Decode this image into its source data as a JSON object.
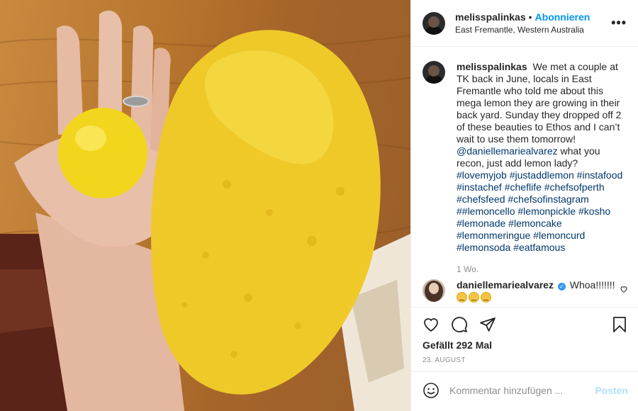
{
  "post": {
    "username": "melisspalinkas",
    "dot": "•",
    "follow_label": "Abonnieren",
    "location": "East Fremantle, Western Australia",
    "more_label": "•••"
  },
  "caption": {
    "username": "melisspalinkas",
    "text": "We met a couple at TK back in June, locals in East Fremantle who told me about this mega lemon they are growing in their back yard. Sunday they dropped off 2 of these beauties to Ethos and I can’t wait to use them tomorrow!",
    "mention": "@daniellemariealvarez",
    "text2": "what you recon, just add lemon lady?",
    "hashtags": [
      "#lovemyjob",
      "#justaddlemon",
      "#instafood",
      "#instachef",
      "#cheflife",
      "#chefsofperth",
      "#chefsfeed",
      "#chefsofinstagram",
      "##lemoncello",
      "#lemonpickle",
      "#kosho",
      "#lemonade",
      "#lemoncake",
      "#lemonmeringue",
      "#lemoncurd",
      "#lemonsoda",
      "#eatfamous"
    ],
    "age": "1 Wo."
  },
  "comment": {
    "username": "daniellemariealvarez",
    "verified_glyph": "✓",
    "text": "Whoa!!!!!!!"
  },
  "icons": {
    "like": "heart-icon",
    "comment": "comment-icon",
    "share": "paper-plane-icon",
    "save": "bookmark-icon",
    "emoji": "smiley-icon",
    "more": "ellipsis-icon"
  },
  "likes": "Gefällt 292 Mal",
  "date": "23. AUGUST",
  "comment_box": {
    "placeholder": "Kommentar hinzufügen ...",
    "post_label": "Posten"
  },
  "colors": {
    "accent": "#0095f6",
    "post_disabled": "#b2dffc",
    "link": "#00376b",
    "muted": "#8e8e8e"
  }
}
